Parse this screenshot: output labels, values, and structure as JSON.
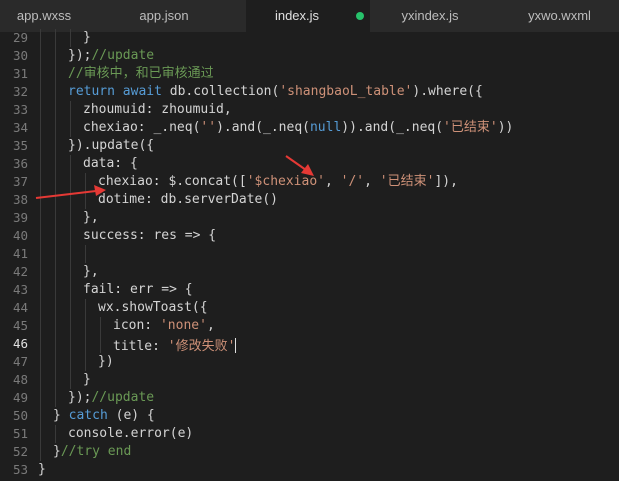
{
  "tabs": [
    {
      "label": "app.wxss",
      "active": false
    },
    {
      "label": "app.json",
      "active": false
    },
    {
      "label": "index.js",
      "active": true,
      "modified": true
    },
    {
      "label": "yxindex.js",
      "active": false
    },
    {
      "label": "yxwo.wxml",
      "active": false
    }
  ],
  "colors": {
    "keyword": "#569cd6",
    "string": "#ce9178",
    "comment": "#6a9955",
    "text": "#d4d4d4",
    "arrow": "#e53935"
  },
  "editor": {
    "current_line": 46,
    "lines": [
      {
        "n": 29,
        "indent": 4,
        "tokens": [
          {
            "t": "}",
            "c": "text"
          }
        ]
      },
      {
        "n": 30,
        "indent": 3,
        "tokens": [
          {
            "t": "});",
            "c": "text"
          },
          {
            "t": "//update",
            "c": "comment"
          }
        ]
      },
      {
        "n": 31,
        "indent": 3,
        "tokens": [
          {
            "t": "//审核中，和已审核通过",
            "c": "comment"
          }
        ]
      },
      {
        "n": 32,
        "indent": 3,
        "tokens": [
          {
            "t": "return await ",
            "c": "keyword"
          },
          {
            "t": "db.collection(",
            "c": "text"
          },
          {
            "t": "'shangbaoL_table'",
            "c": "string"
          },
          {
            "t": ").where({",
            "c": "text"
          }
        ]
      },
      {
        "n": 33,
        "indent": 4,
        "tokens": [
          {
            "t": "zhoumuid: zhoumuid,",
            "c": "text"
          }
        ]
      },
      {
        "n": 34,
        "indent": 4,
        "tokens": [
          {
            "t": "chexiao: _.neq(",
            "c": "text"
          },
          {
            "t": "''",
            "c": "string"
          },
          {
            "t": ").and(_.neq(",
            "c": "text"
          },
          {
            "t": "null",
            "c": "keyword"
          },
          {
            "t": ")).and(_.neq(",
            "c": "text"
          },
          {
            "t": "'已结束'",
            "c": "string"
          },
          {
            "t": "))",
            "c": "text"
          }
        ]
      },
      {
        "n": 35,
        "indent": 3,
        "tokens": [
          {
            "t": "}).update({",
            "c": "text"
          }
        ]
      },
      {
        "n": 36,
        "indent": 4,
        "tokens": [
          {
            "t": "data: {",
            "c": "text"
          }
        ]
      },
      {
        "n": 37,
        "indent": 5,
        "tokens": [
          {
            "t": "chexiao: $.concat([",
            "c": "text"
          },
          {
            "t": "'$chexiao'",
            "c": "string"
          },
          {
            "t": ", ",
            "c": "text"
          },
          {
            "t": "'/'",
            "c": "string"
          },
          {
            "t": ", ",
            "c": "text"
          },
          {
            "t": "'已结束'",
            "c": "string"
          },
          {
            "t": "]),",
            "c": "text"
          }
        ]
      },
      {
        "n": 38,
        "indent": 5,
        "tokens": [
          {
            "t": "dotime: db.serverDate()",
            "c": "text"
          }
        ]
      },
      {
        "n": 39,
        "indent": 4,
        "tokens": [
          {
            "t": "},",
            "c": "text"
          }
        ]
      },
      {
        "n": 40,
        "indent": 4,
        "tokens": [
          {
            "t": "success: res => {",
            "c": "text"
          }
        ]
      },
      {
        "n": 41,
        "indent": 5,
        "tokens": []
      },
      {
        "n": 42,
        "indent": 4,
        "tokens": [
          {
            "t": "},",
            "c": "text"
          }
        ]
      },
      {
        "n": 43,
        "indent": 4,
        "tokens": [
          {
            "t": "fail: err => {",
            "c": "text"
          }
        ]
      },
      {
        "n": 44,
        "indent": 5,
        "tokens": [
          {
            "t": "wx.showToast({",
            "c": "text"
          }
        ]
      },
      {
        "n": 45,
        "indent": 6,
        "tokens": [
          {
            "t": "icon: ",
            "c": "text"
          },
          {
            "t": "'none'",
            "c": "string"
          },
          {
            "t": ",",
            "c": "text"
          }
        ]
      },
      {
        "n": 46,
        "indent": 6,
        "tokens": [
          {
            "t": "title: ",
            "c": "text"
          },
          {
            "t": "'修改失败'",
            "c": "string"
          }
        ]
      },
      {
        "n": 47,
        "indent": 5,
        "tokens": [
          {
            "t": "})",
            "c": "text"
          }
        ]
      },
      {
        "n": 48,
        "indent": 4,
        "tokens": [
          {
            "t": "}",
            "c": "text"
          }
        ]
      },
      {
        "n": 49,
        "indent": 3,
        "tokens": [
          {
            "t": "});",
            "c": "text"
          },
          {
            "t": "//update",
            "c": "comment"
          }
        ]
      },
      {
        "n": 50,
        "indent": 2,
        "tokens": [
          {
            "t": "} ",
            "c": "text"
          },
          {
            "t": "catch",
            "c": "keyword"
          },
          {
            "t": " (e) {",
            "c": "text"
          }
        ]
      },
      {
        "n": 51,
        "indent": 3,
        "tokens": [
          {
            "t": "console.error(e)",
            "c": "text"
          }
        ]
      },
      {
        "n": 52,
        "indent": 2,
        "tokens": [
          {
            "t": "}",
            "c": "text"
          },
          {
            "t": "//try end",
            "c": "comment"
          }
        ]
      },
      {
        "n": 53,
        "indent": 1,
        "tokens": [
          {
            "t": "}",
            "c": "text"
          }
        ]
      }
    ]
  }
}
